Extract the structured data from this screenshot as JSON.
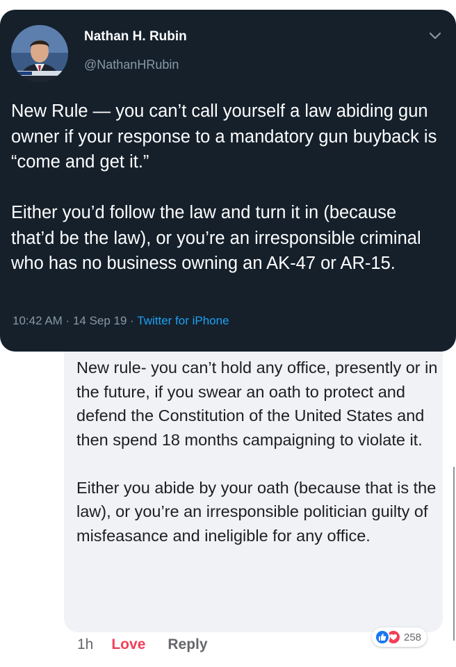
{
  "tweet": {
    "display_name": "Nathan H. Rubin",
    "handle": "@NathanHRubin",
    "avatar_icon": "profile-photo",
    "menu_icon": "chevron-down-icon",
    "body": "New Rule — you can’t call yourself a law abiding gun owner if your response to a mandatory gun buyback is “come and get it.”\n\nEither you’d follow the law and turn it in (because that’d be the law), or you’re an irresponsible criminal who has no business owning an AK-47 or AR-15.",
    "time": "10:42 AM",
    "date": "14 Sep 19",
    "separator": " · ",
    "source": "Twitter for iPhone",
    "background_color": "#15202b",
    "link_color": "#1da1f2"
  },
  "comment": {
    "body": "New rule- you can’t hold any office, presently or in the future, if you swear an oath to protect and defend the Constitution of the United States and then spend 18 months campaigning to violate it.\n\nEither you abide by your oath (because that is the law), or you’re an irresponsible politician guilty of misfeasance and ineligible for any office.",
    "time": "1h",
    "love_label": "Love",
    "reply_label": "Reply",
    "reaction_icons": [
      "like-icon",
      "love-icon"
    ],
    "reaction_count": "258",
    "love_color": "#f33e58",
    "like_color": "#1877f2"
  }
}
